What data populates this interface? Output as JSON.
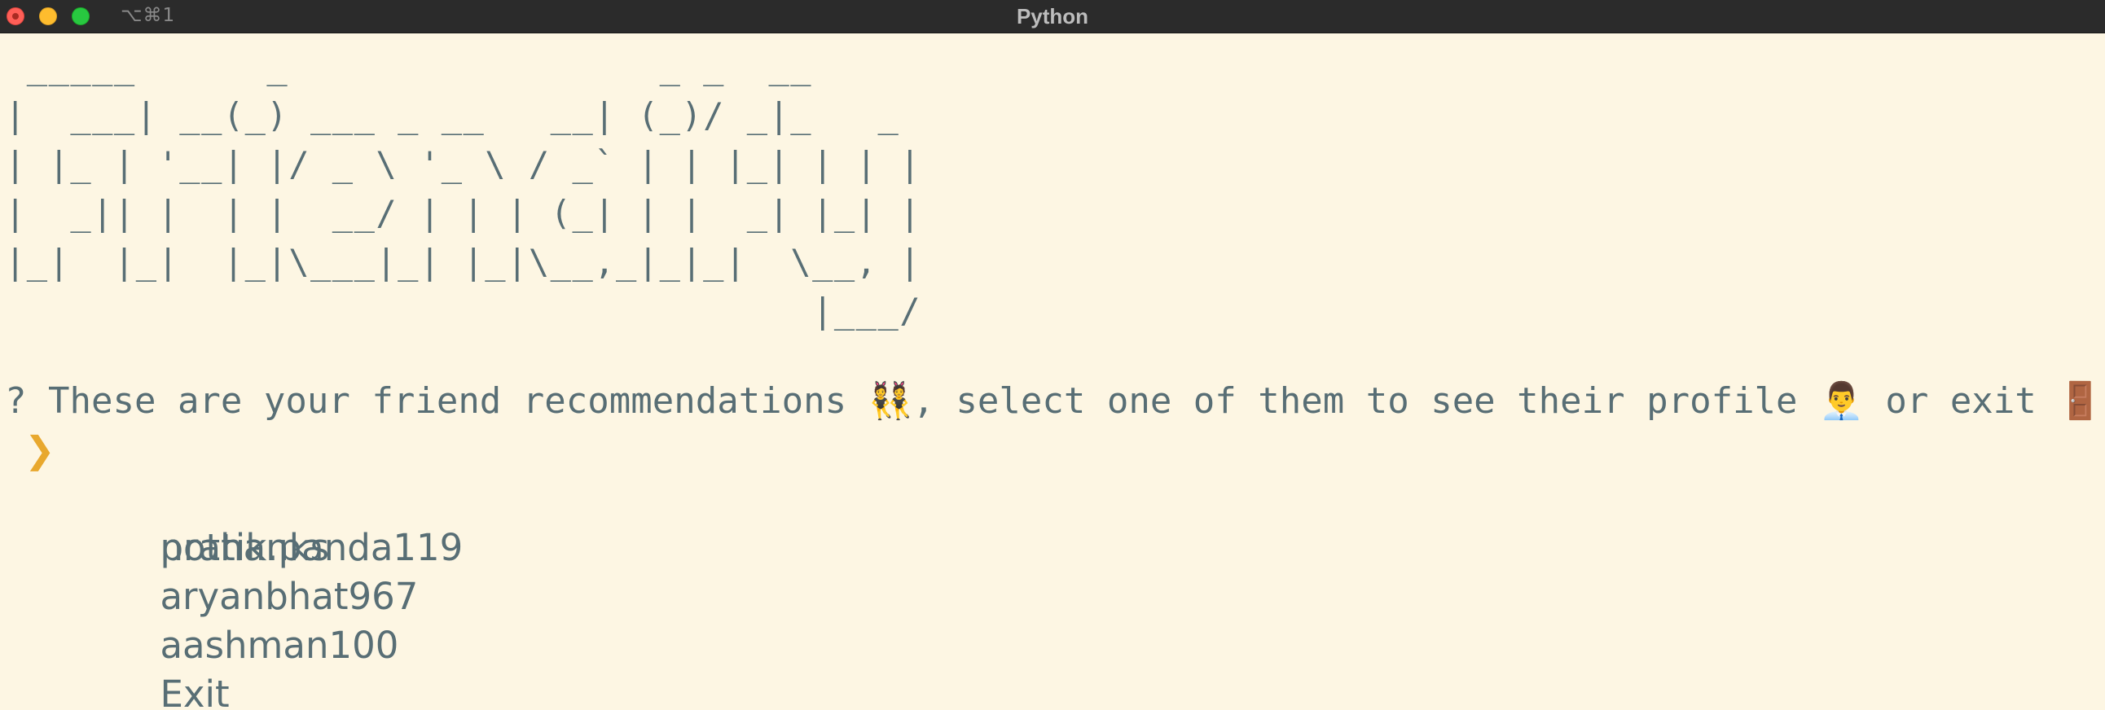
{
  "window": {
    "shortcut": "⌥⌘1",
    "title": "Python"
  },
  "banner": {
    "lines": [
      " _____      _                 _ _  __       ",
      "|  ___| __(_) ___ _ __   __| (_)/ _|_   _ ",
      "| |_ | '__| |/ _ \\ '_ \\ / _` | | |_| | | |",
      "|  _|| |  | |  __/ | | | (_| | |  _| |_| |",
      "|_|  |_|  |_|\\___|_| |_|\\__,_|_|_|  \\__, |",
      "                                     |___/ "
    ]
  },
  "prompt": {
    "mark": "?",
    "text_part1": "These are your friend recommendations",
    "emoji1": "👯",
    "text_part2": ", select one of them to see their profile",
    "emoji2": "👨‍💼",
    "text_part3": "or exit",
    "emoji3": "🚪"
  },
  "menu": {
    "pointer": "❯",
    "selected_index": 0,
    "options": [
      "pratik.panda119",
      "nothanks",
      "aryanbhat967",
      "aashman100",
      "Exit"
    ]
  },
  "colors": {
    "background": "#fdf6e3",
    "text": "#586e75",
    "pointer": "#e8a82e",
    "titlebar": "#2b2b2b"
  }
}
